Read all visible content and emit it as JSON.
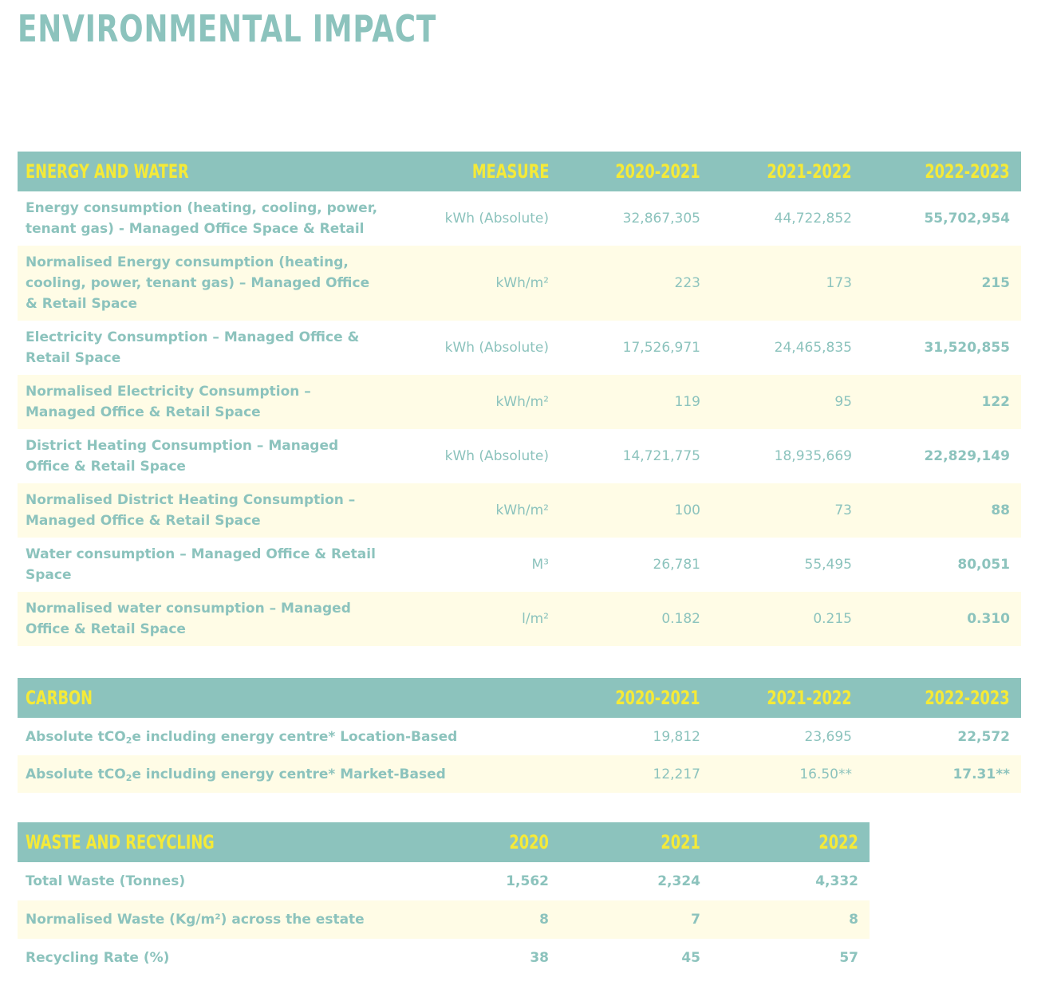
{
  "title": "ENVIRONMENTAL IMPACT",
  "energy": {
    "headers": [
      "ENERGY AND WATER",
      "MEASURE",
      "2020-2021",
      "2021-2022",
      "2022-2023"
    ],
    "rows": [
      {
        "label": "Energy consumption (heating, cooling, power, tenant gas) - Managed Office Space & Retail",
        "measure": "kWh (Absolute)",
        "v1": "32,867,305",
        "v2": "44,722,852",
        "v3": "55,702,954"
      },
      {
        "label": "Normalised Energy consumption (heating, cooling, power, tenant gas) – Managed Office & Retail Space",
        "measure": "kWh/m²",
        "v1": "223",
        "v2": "173",
        "v3": "215"
      },
      {
        "label": "Electricity Consumption – Managed Office & Retail Space",
        "measure": "kWh (Absolute)",
        "v1": "17,526,971",
        "v2": "24,465,835",
        "v3": "31,520,855"
      },
      {
        "label": "Normalised Electricity Consumption – Managed Office & Retail Space",
        "measure": "kWh/m²",
        "v1": "119",
        "v2": "95",
        "v3": "122"
      },
      {
        "label": "District Heating Consumption – Managed Office & Retail Space",
        "measure": "kWh (Absolute)",
        "v1": "14,721,775",
        "v2": "18,935,669",
        "v3": "22,829,149"
      },
      {
        "label": "Normalised District Heating Consumption – Managed Office & Retail Space",
        "measure": "kWh/m²",
        "v1": "100",
        "v2": "73",
        "v3": "88"
      },
      {
        "label": "Water consumption – Managed Office & Retail Space",
        "measure": "M³",
        "v1": "26,781",
        "v2": "55,495",
        "v3": "80,051"
      },
      {
        "label": "Normalised water consumption – Managed Office & Retail Space",
        "measure": "l/m²",
        "v1": "0.182",
        "v2": "0.215",
        "v3": "0.310"
      }
    ]
  },
  "carbon": {
    "headers": [
      "CARBON",
      "2020-2021",
      "2021-2022",
      "2022-2023"
    ],
    "rows": [
      {
        "label_pre": "Absolute tCO",
        "label_sub": "2",
        "label_post": "e including energy centre* Location-Based",
        "v1": "19,812",
        "v2": "23,695",
        "v3": "22,572"
      },
      {
        "label_pre": "Absolute tCO",
        "label_sub": "2",
        "label_post": "e including energy centre* Market-Based",
        "v1": "12,217",
        "v2": "16.50**",
        "v3": "17.31**"
      }
    ]
  },
  "waste": {
    "headers": [
      "WASTE AND RECYCLING",
      "2020",
      "2021",
      "2022"
    ],
    "rows": [
      {
        "label": "Total Waste (Tonnes)",
        "v1": "1,562",
        "v2": "2,324",
        "v3": "4,332"
      },
      {
        "label": "Normalised Waste (Kg/m²) across the estate",
        "v1": "8",
        "v2": "7",
        "v3": "8"
      },
      {
        "label": "Recycling Rate (%)",
        "v1": "38",
        "v2": "45",
        "v3": "57"
      }
    ]
  }
}
